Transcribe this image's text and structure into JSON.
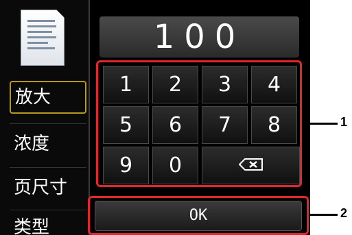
{
  "display": {
    "value": "100"
  },
  "menu": {
    "items": [
      {
        "label": "放大",
        "selected": true
      },
      {
        "label": "浓度",
        "selected": false
      },
      {
        "label": "页尺寸",
        "selected": false
      },
      {
        "label": "类型",
        "selected": false
      }
    ]
  },
  "keypad": {
    "keys": [
      "1",
      "2",
      "3",
      "4",
      "5",
      "6",
      "7",
      "8",
      "9",
      "0"
    ],
    "backspace_icon": "backspace-icon"
  },
  "ok_button": {
    "label": "OK"
  },
  "callouts": {
    "keypad": "1",
    "ok": "2"
  },
  "colors": {
    "highlight": "#e3262c",
    "selected_border": "#b59a1e"
  }
}
